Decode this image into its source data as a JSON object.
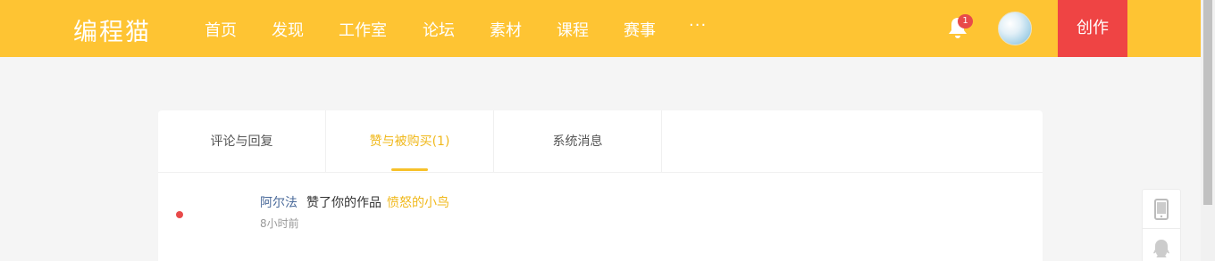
{
  "header": {
    "logo": "编程猫",
    "nav": [
      "首页",
      "发现",
      "工作室",
      "论坛",
      "素材",
      "课程",
      "赛事"
    ],
    "more": "···",
    "notification_count": "1",
    "create_label": "创作"
  },
  "tabs": [
    {
      "label": "评论与回复",
      "active": false
    },
    {
      "label": "赞与被购买(1)",
      "active": true
    },
    {
      "label": "系统消息",
      "active": false
    }
  ],
  "messages": [
    {
      "user": "阿尔法",
      "action": "赞了你的作品",
      "work": "愤怒的小鸟",
      "time": "8小时前",
      "unread": true
    }
  ],
  "side_tools": [
    "phone-icon",
    "qq-icon"
  ],
  "colors": {
    "header_bg": "#fec433",
    "create_bg": "#ef4444",
    "accent": "#f0b81a",
    "unread_dot": "#e84a4a"
  }
}
